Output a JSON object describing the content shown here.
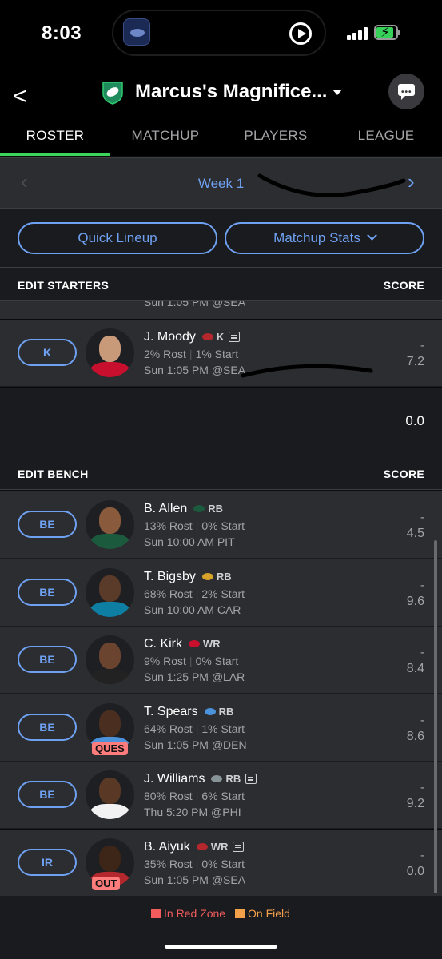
{
  "status_bar": {
    "time": "8:03"
  },
  "header": {
    "team_name": "Marcus's Magnifice...",
    "back_label": "<"
  },
  "tabs": [
    {
      "label": "ROSTER",
      "active": true
    },
    {
      "label": "MATCHUP",
      "active": false
    },
    {
      "label": "PLAYERS",
      "active": false
    },
    {
      "label": "LEAGUE",
      "active": false
    }
  ],
  "week_nav": {
    "label": "Week 1",
    "prev": "‹",
    "next": "›"
  },
  "actions": {
    "quick_lineup": "Quick Lineup",
    "matchup_stats": "Matchup Stats"
  },
  "starters": {
    "title": "EDIT STARTERS",
    "score_label": "SCORE",
    "partial_game": "Sun 1:05 PM @SEA",
    "players": [
      {
        "slot": "K",
        "name": "J. Moody",
        "pos": "K",
        "team_color": "#b3272d",
        "news": true,
        "rost": "2% Rost",
        "start": "1% Start",
        "game": "Sun 1:05 PM @SEA",
        "score": "-",
        "proj": "7.2",
        "tag": ""
      }
    ],
    "total": "0.0"
  },
  "bench": {
    "title": "EDIT BENCH",
    "score_label": "SCORE",
    "players": [
      {
        "slot": "BE",
        "name": "B. Allen",
        "pos": "RB",
        "team_color": "#1c5a3e",
        "news": false,
        "rost": "13% Rost",
        "start": "0% Start",
        "game": "Sun 10:00 AM PIT",
        "score": "-",
        "proj": "4.5",
        "tag": ""
      },
      {
        "slot": "BE",
        "name": "T. Bigsby",
        "pos": "RB",
        "team_color": "#d7a22a",
        "news": false,
        "rost": "68% Rost",
        "start": "2% Start",
        "game": "Sun 10:00 AM CAR",
        "score": "-",
        "proj": "9.6",
        "tag": ""
      },
      {
        "slot": "BE",
        "name": "C. Kirk",
        "pos": "WR",
        "team_color": "#c8102e",
        "news": false,
        "rost": "9% Rost",
        "start": "0% Start",
        "game": "Sun 1:25 PM @LAR",
        "score": "-",
        "proj": "8.4",
        "tag": ""
      },
      {
        "slot": "BE",
        "name": "T. Spears",
        "pos": "RB",
        "team_color": "#4b92db",
        "news": false,
        "rost": "64% Rost",
        "start": "1% Start",
        "game": "Sun 1:05 PM @DEN",
        "score": "-",
        "proj": "8.6",
        "tag": "QUES"
      },
      {
        "slot": "BE",
        "name": "J. Williams",
        "pos": "RB",
        "team_color": "#869397",
        "news": true,
        "rost": "80% Rost",
        "start": "6% Start",
        "game": "Thu 5:20 PM @PHI",
        "score": "-",
        "proj": "9.2",
        "tag": ""
      },
      {
        "slot": "IR",
        "name": "B. Aiyuk",
        "pos": "WR",
        "team_color": "#b3272d",
        "news": true,
        "rost": "35% Rost",
        "start": "0% Start",
        "game": "Sun 1:05 PM @SEA",
        "score": "-",
        "proj": "0.0",
        "tag": "OUT"
      }
    ]
  },
  "legend": {
    "red_zone": "In Red Zone",
    "on_field": "On Field",
    "red_zone_color": "#f25c5c",
    "on_field_color": "#f5a04a"
  }
}
